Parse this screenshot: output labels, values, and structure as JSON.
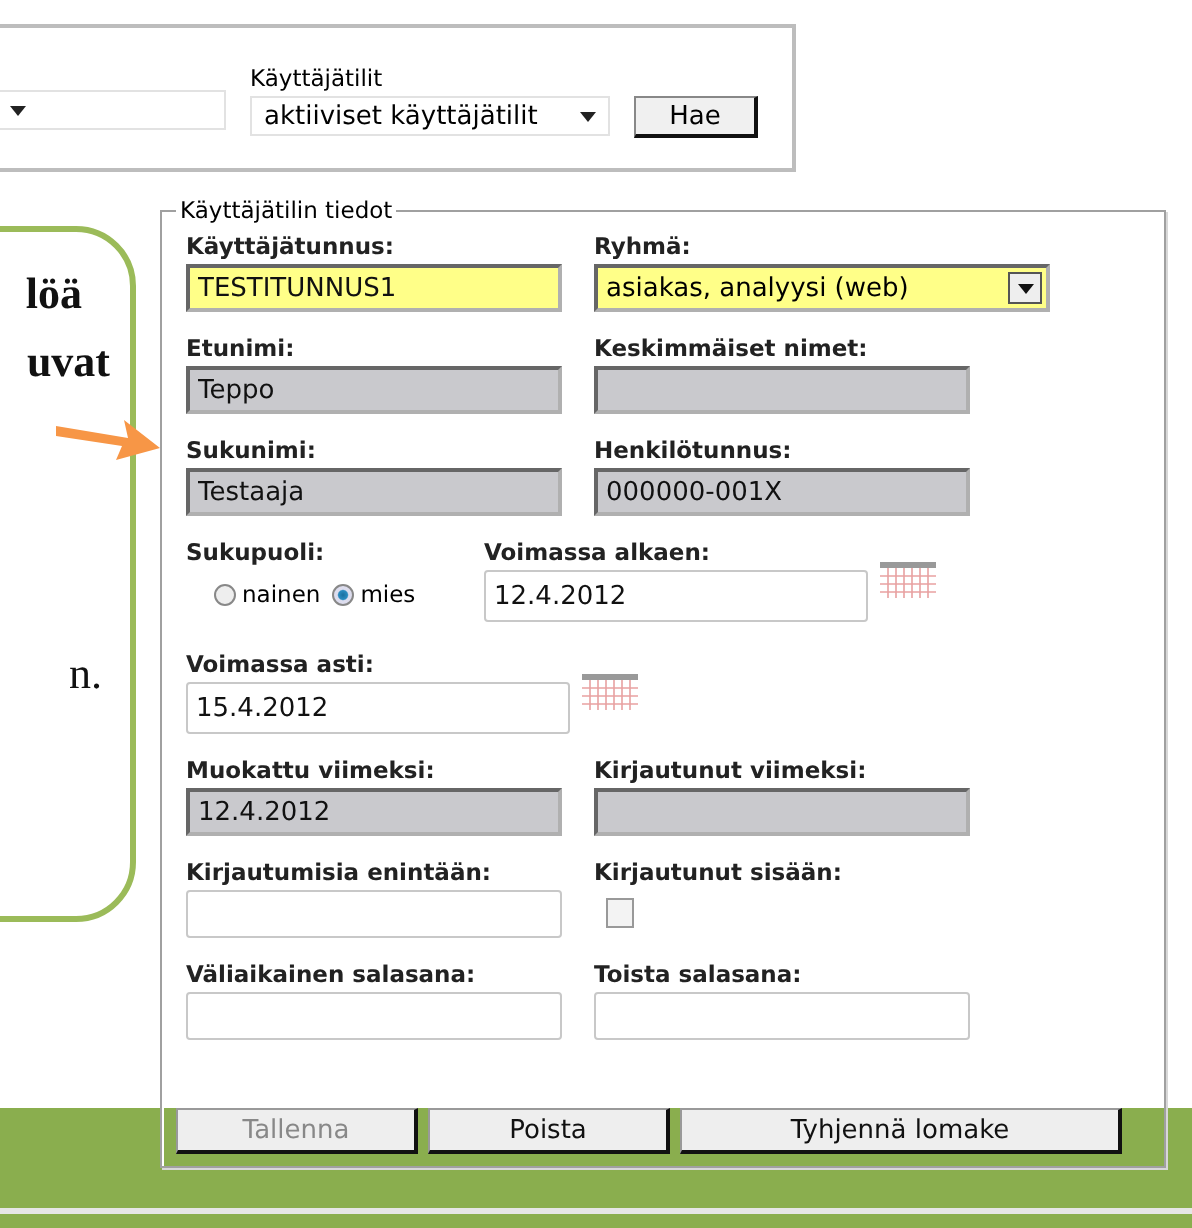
{
  "search_panel": {
    "account_filter": {
      "label": "Käyttäjätilit",
      "value": "aktiiviset käyttäjätilit"
    },
    "search_button": "Hae"
  },
  "callout": {
    "lines": [
      {
        "text": "löä",
        "bold": true
      },
      {
        "text": "uvat",
        "bold": true
      },
      {
        "text": "n.",
        "bold": false
      }
    ]
  },
  "form": {
    "legend": "Käyttäjätilin tiedot",
    "rows": [
      [
        {
          "kind": "text",
          "label": "Käyttäjätunnus:",
          "value": "TESTITUNNUS1",
          "required": true,
          "readonly": false
        },
        {
          "kind": "select",
          "label": "Ryhmä:",
          "value": "asiakas, analyysi (web)",
          "required": true,
          "readonly": false
        }
      ],
      [
        {
          "kind": "text",
          "label": "Etunimi:",
          "value": "Teppo",
          "required": false,
          "readonly": true
        },
        {
          "kind": "text",
          "label": "Keskimmäiset nimet:",
          "required": false,
          "readonly": true
        }
      ],
      [
        {
          "kind": "text",
          "label": "Sukunimi:",
          "value": "Testaaja",
          "required": false,
          "readonly": true
        },
        {
          "kind": "text",
          "label": "Henkilötunnus:",
          "value": "000000-001X",
          "required": false,
          "readonly": true
        }
      ],
      [
        {
          "kind": "radio",
          "label": "Sukupuoli:",
          "options": [
            {
              "label": "nainen",
              "selected": false
            },
            {
              "label": "mies",
              "selected": true
            }
          ]
        },
        {
          "kind": "date",
          "label": "Voimassa alkaen:",
          "value": "12.4.2012",
          "required": false,
          "readonly": false
        }
      ],
      [
        {
          "kind": "date",
          "label": "Voimassa asti:",
          "value": "15.4.2012",
          "required": false,
          "readonly": false
        }
      ],
      [
        {
          "kind": "text",
          "label": "Muokattu viimeksi:",
          "value": "12.4.2012",
          "required": false,
          "readonly": true
        },
        {
          "kind": "text",
          "label": "Kirjautunut viimeksi:",
          "required": false,
          "readonly": true
        }
      ],
      [
        {
          "kind": "text",
          "label": "Kirjautumisia enintään:",
          "required": false,
          "readonly": false
        },
        {
          "kind": "checkbox",
          "label": "Kirjautunut sisään:",
          "checked": false
        }
      ],
      [
        {
          "kind": "text",
          "label": "Väliaikainen salasana:",
          "required": false,
          "readonly": false
        },
        {
          "kind": "text",
          "label": "Toista salasana:",
          "required": false,
          "readonly": false
        }
      ]
    ],
    "buttons": [
      {
        "label": "Tallenna",
        "disabled": true
      },
      {
        "label": "Poista",
        "disabled": false
      },
      {
        "label": "Tyhjennä lomake",
        "disabled": false
      }
    ]
  }
}
